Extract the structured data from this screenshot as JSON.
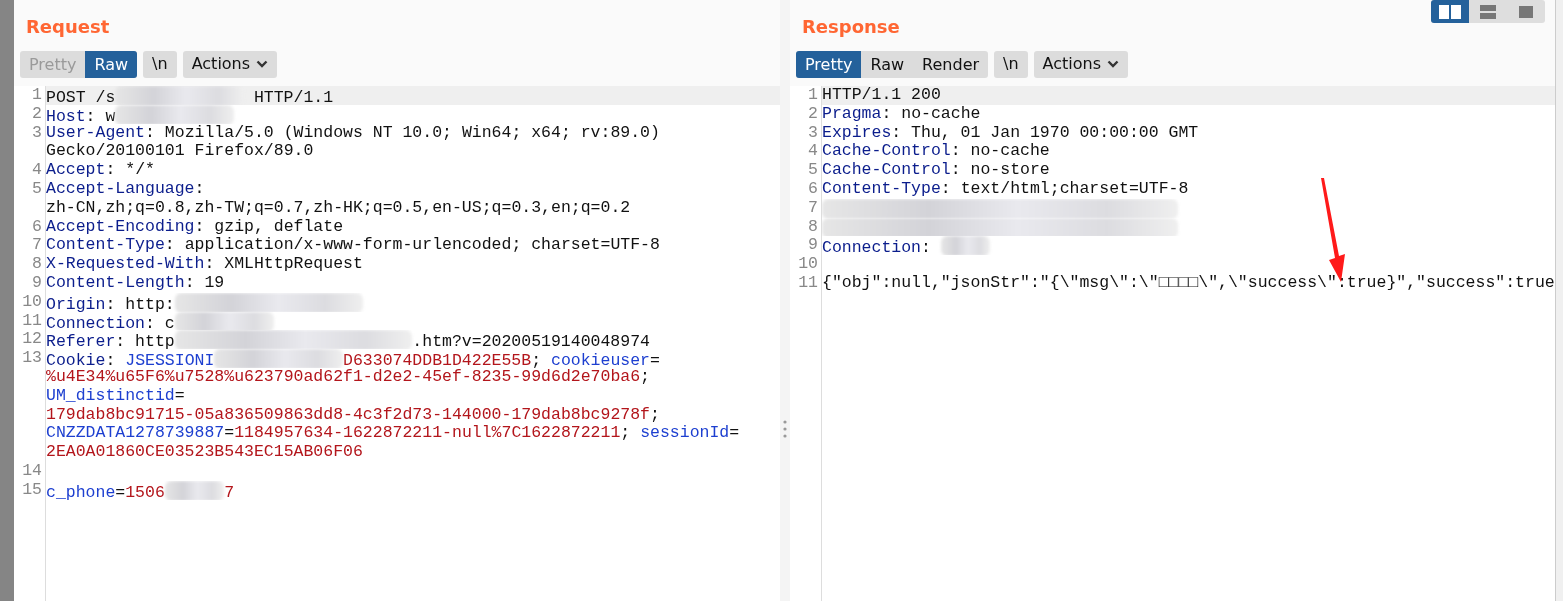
{
  "request": {
    "title": "Request",
    "view_tabs": [
      {
        "label": "Pretty",
        "selected": false,
        "disabled": true
      },
      {
        "label": "Raw",
        "selected": true,
        "disabled": false
      }
    ],
    "newline_button": "\\n",
    "actions_button": "Actions",
    "lines": [
      {
        "number": "1",
        "highlighted": true,
        "wrapped_lines": [
          {
            "segments": [
              {
                "kind": "plain",
                "text": "POST /s"
              },
              {
                "kind": "redaction"
              },
              {
                "kind": "plain",
                "text": " HTTP/1.1"
              }
            ]
          }
        ]
      },
      {
        "number": "2",
        "highlighted": false,
        "wrapped_lines": [
          {
            "segments": [
              {
                "kind": "header",
                "text": "Host"
              },
              {
                "kind": "plain",
                "text": ": w"
              },
              {
                "kind": "redaction"
              }
            ]
          }
        ]
      },
      {
        "number": "3",
        "highlighted": false,
        "wrapped_lines": [
          {
            "segments": [
              {
                "kind": "header",
                "text": "User-Agent"
              },
              {
                "kind": "plain",
                "text": ": Mozilla/5.0 (Windows NT 10.0; Win64; x64; rv:89.0)"
              }
            ]
          },
          {
            "segments": [
              {
                "kind": "plain",
                "text": "Gecko/20100101 Firefox/89.0"
              }
            ]
          }
        ]
      },
      {
        "number": "4",
        "highlighted": false,
        "wrapped_lines": [
          {
            "segments": [
              {
                "kind": "header",
                "text": "Accept"
              },
              {
                "kind": "plain",
                "text": ": */*"
              }
            ]
          }
        ]
      },
      {
        "number": "5",
        "highlighted": false,
        "wrapped_lines": [
          {
            "segments": [
              {
                "kind": "header",
                "text": "Accept-Language"
              },
              {
                "kind": "plain",
                "text": ":"
              }
            ]
          },
          {
            "segments": [
              {
                "kind": "plain",
                "text": "zh-CN,zh;q=0.8,zh-TW;q=0.7,zh-HK;q=0.5,en-US;q=0.3,en;q=0.2"
              }
            ]
          }
        ]
      },
      {
        "number": "6",
        "highlighted": false,
        "wrapped_lines": [
          {
            "segments": [
              {
                "kind": "header",
                "text": "Accept-Encoding"
              },
              {
                "kind": "plain",
                "text": ": gzip, deflate"
              }
            ]
          }
        ]
      },
      {
        "number": "7",
        "highlighted": false,
        "wrapped_lines": [
          {
            "segments": [
              {
                "kind": "header",
                "text": "Content-Type"
              },
              {
                "kind": "plain",
                "text": ": application/x-www-form-urlencoded; charset=UTF-8"
              }
            ]
          }
        ]
      },
      {
        "number": "8",
        "highlighted": false,
        "wrapped_lines": [
          {
            "segments": [
              {
                "kind": "header",
                "text": "X-Requested-With"
              },
              {
                "kind": "plain",
                "text": ": XMLHttpRequest"
              }
            ]
          }
        ]
      },
      {
        "number": "9",
        "highlighted": false,
        "wrapped_lines": [
          {
            "segments": [
              {
                "kind": "header",
                "text": "Content-Length"
              },
              {
                "kind": "plain",
                "text": ": 19"
              }
            ]
          }
        ]
      },
      {
        "number": "10",
        "highlighted": false,
        "wrapped_lines": [
          {
            "segments": [
              {
                "kind": "header",
                "text": "Origin"
              },
              {
                "kind": "plain",
                "text": ": http:"
              },
              {
                "kind": "redaction"
              }
            ]
          }
        ]
      },
      {
        "number": "11",
        "highlighted": false,
        "wrapped_lines": [
          {
            "segments": [
              {
                "kind": "header",
                "text": "Connection"
              },
              {
                "kind": "plain",
                "text": ": c"
              },
              {
                "kind": "redaction"
              }
            ]
          }
        ]
      },
      {
        "number": "12",
        "highlighted": false,
        "wrapped_lines": [
          {
            "segments": [
              {
                "kind": "header",
                "text": "Referer"
              },
              {
                "kind": "plain",
                "text": ": http"
              },
              {
                "kind": "redaction"
              },
              {
                "kind": "plain",
                "text": ".htm?v=20200519140048974"
              }
            ]
          }
        ]
      },
      {
        "number": "13",
        "highlighted": false,
        "wrapped_lines": [
          {
            "segments": [
              {
                "kind": "header",
                "text": "Cookie"
              },
              {
                "kind": "plain",
                "text": ": "
              },
              {
                "kind": "cookie-name",
                "text": "JSESSIONI"
              },
              {
                "kind": "redaction"
              },
              {
                "kind": "cookie-value",
                "text": "D633074DDB1D422E55B"
              },
              {
                "kind": "plain",
                "text": "; "
              },
              {
                "kind": "cookie-name",
                "text": "cookieuser"
              },
              {
                "kind": "plain",
                "text": "="
              }
            ]
          },
          {
            "segments": [
              {
                "kind": "cookie-value",
                "text": "%u4E34%u65F6%u7528%u623790ad62f1-d2e2-45ef-8235-99d6d2e70ba6"
              },
              {
                "kind": "plain",
                "text": ";"
              }
            ]
          },
          {
            "segments": [
              {
                "kind": "cookie-name",
                "text": "UM_distinctid"
              },
              {
                "kind": "plain",
                "text": "="
              }
            ]
          },
          {
            "segments": [
              {
                "kind": "cookie-value",
                "text": "179dab8bc91715-05a836509863dd8-4c3f2d73-144000-179dab8bc9278f"
              },
              {
                "kind": "plain",
                "text": ";"
              }
            ]
          },
          {
            "segments": [
              {
                "kind": "cookie-name",
                "text": "CNZZDATA1278739887"
              },
              {
                "kind": "plain",
                "text": "="
              },
              {
                "kind": "cookie-value",
                "text": "1184957634-1622872211-null%7C1622872211"
              },
              {
                "kind": "plain",
                "text": "; "
              },
              {
                "kind": "cookie-name",
                "text": "sessionId"
              },
              {
                "kind": "plain",
                "text": "="
              }
            ]
          },
          {
            "segments": [
              {
                "kind": "cookie-value",
                "text": "2EA0A01860CE03523B543EC15AB06F06"
              }
            ]
          }
        ]
      },
      {
        "number": "14",
        "highlighted": false
      },
      {
        "number": "15",
        "highlighted": false,
        "wrapped_lines": [
          {
            "segments": [
              {
                "kind": "cookie-name",
                "text": "c_phone"
              },
              {
                "kind": "plain",
                "text": "="
              },
              {
                "kind": "cookie-value",
                "text": "1506"
              },
              {
                "kind": "redaction"
              },
              {
                "kind": "cookie-value",
                "text": "7"
              }
            ]
          }
        ]
      }
    ]
  },
  "response": {
    "title": "Response",
    "view_tabs": [
      {
        "label": "Pretty",
        "selected": true,
        "disabled": false
      },
      {
        "label": "Raw",
        "selected": false,
        "disabled": false
      },
      {
        "label": "Render",
        "selected": false,
        "disabled": false
      }
    ],
    "newline_button": "\\n",
    "actions_button": "Actions",
    "lines": [
      {
        "number": "1",
        "highlighted": true,
        "wrapped_lines": [
          {
            "segments": [
              {
                "kind": "plain",
                "text": "HTTP/1.1 200"
              }
            ]
          }
        ]
      },
      {
        "number": "2",
        "highlighted": false,
        "wrapped_lines": [
          {
            "segments": [
              {
                "kind": "header",
                "text": "Pragma"
              },
              {
                "kind": "plain",
                "text": ": no-cache"
              }
            ]
          }
        ]
      },
      {
        "number": "3",
        "highlighted": false,
        "wrapped_lines": [
          {
            "segments": [
              {
                "kind": "header",
                "text": "Expires"
              },
              {
                "kind": "plain",
                "text": ": Thu, 01 Jan 1970 00:00:00 GMT"
              }
            ]
          }
        ]
      },
      {
        "number": "4",
        "highlighted": false,
        "wrapped_lines": [
          {
            "segments": [
              {
                "kind": "header",
                "text": "Cache-Control"
              },
              {
                "kind": "plain",
                "text": ": no-cache"
              }
            ]
          }
        ]
      },
      {
        "number": "5",
        "highlighted": false,
        "wrapped_lines": [
          {
            "segments": [
              {
                "kind": "header",
                "text": "Cache-Control"
              },
              {
                "kind": "plain",
                "text": ": no-store"
              }
            ]
          }
        ]
      },
      {
        "number": "6",
        "highlighted": false,
        "wrapped_lines": [
          {
            "segments": [
              {
                "kind": "header",
                "text": "Content-Type"
              },
              {
                "kind": "plain",
                "text": ": text/html;charset=UTF-8"
              }
            ]
          }
        ]
      },
      {
        "number": "7",
        "highlighted": false,
        "wrapped_lines": [
          {
            "segments": [
              {
                "kind": "redaction"
              }
            ]
          }
        ]
      },
      {
        "number": "8",
        "highlighted": false,
        "wrapped_lines": [
          {
            "segments": [
              {
                "kind": "redaction"
              }
            ]
          }
        ]
      },
      {
        "number": "9",
        "highlighted": false,
        "wrapped_lines": [
          {
            "segments": [
              {
                "kind": "header",
                "text": "Connection"
              },
              {
                "kind": "plain",
                "text": ": "
              },
              {
                "kind": "redaction"
              }
            ]
          }
        ]
      },
      {
        "number": "10",
        "highlighted": false
      },
      {
        "number": "11",
        "highlighted": false,
        "wrapped_lines": [
          {
            "segments": [
              {
                "kind": "plain",
                "text": "{\"obj\":null,\"jsonStr\":\"{\\\"msg\\\":\\\"□□□□\\\",\\\"success\\\":true}\",\"success\":true"
              }
            ]
          }
        ]
      }
    ]
  },
  "layout_buttons": [
    {
      "kind": "columns",
      "selected": true
    },
    {
      "kind": "rows",
      "selected": false
    },
    {
      "kind": "single",
      "selected": false
    }
  ],
  "arrow_annotation": true
}
